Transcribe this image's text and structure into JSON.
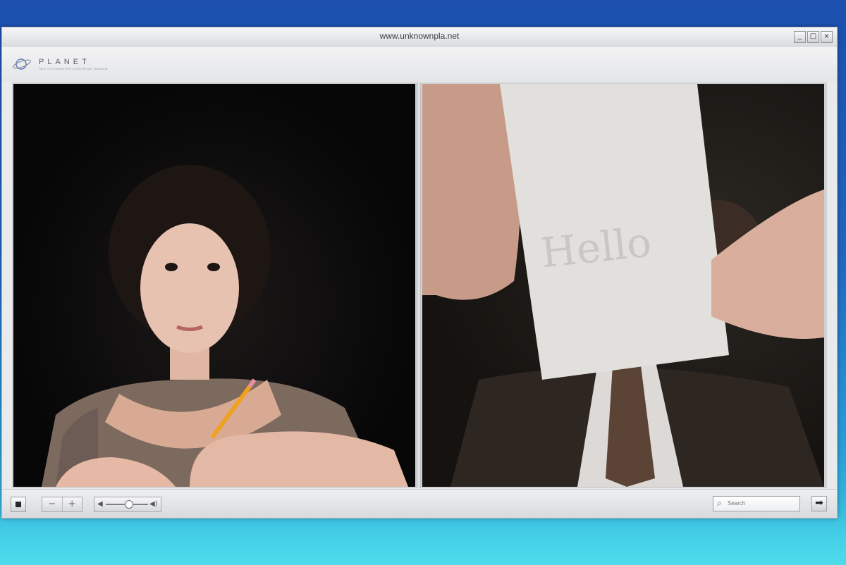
{
  "window": {
    "title": "www.unknownpla.net",
    "controls": {
      "minimize": "_",
      "maximize": "□",
      "close": "×"
    }
  },
  "brand": {
    "name": "PLANET",
    "tagline": "TALK TO STRANGERS. ANONYMOUS. RANDOM."
  },
  "video": {
    "left_feed": {
      "icon": "person-video-icon"
    },
    "right_feed": {
      "icon": "person-video-icon"
    }
  },
  "controls": {
    "stop_icon": "stop-icon",
    "zoom_out": "−",
    "zoom_in": "+",
    "volume_left_icon": "◀",
    "volume_right_icon": "◀)",
    "volume_level": 0.55,
    "search_placeholder": "Search",
    "go_icon": "➡"
  }
}
